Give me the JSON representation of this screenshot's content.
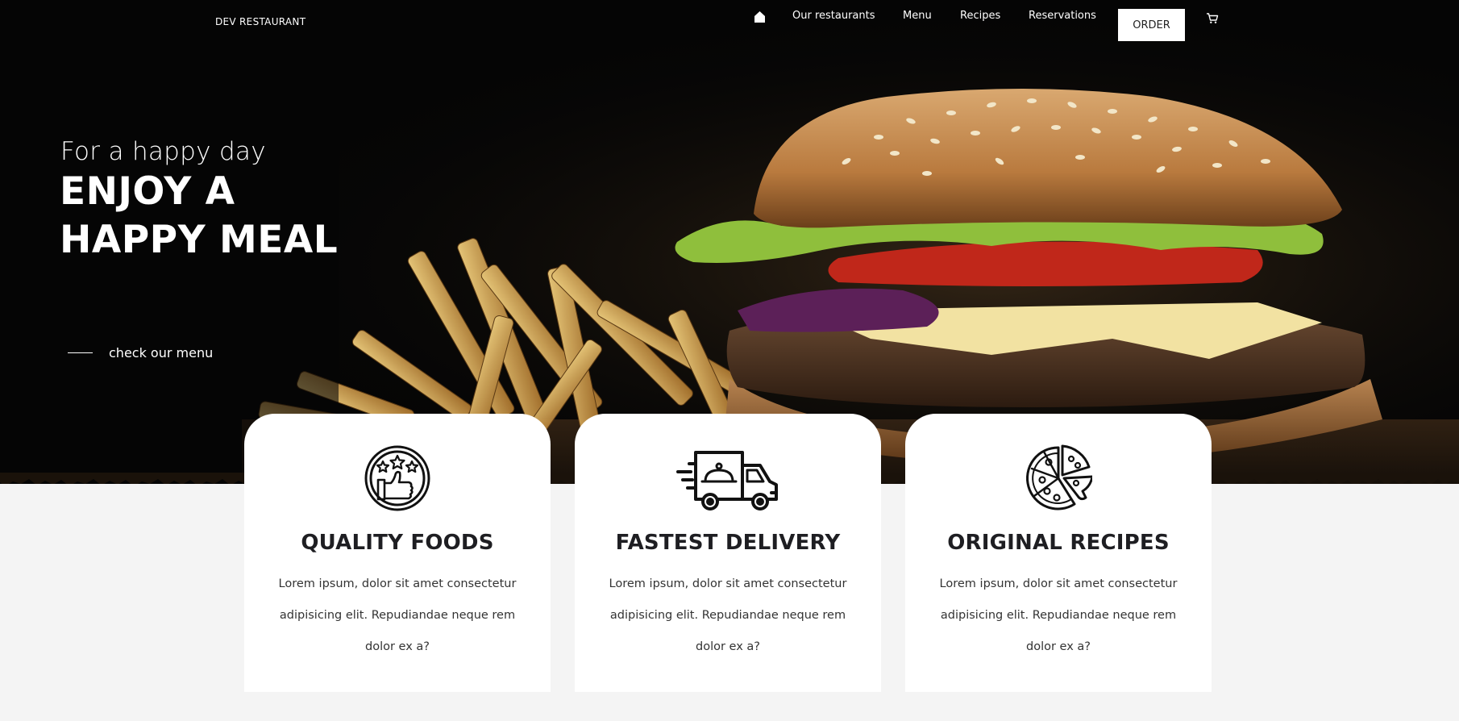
{
  "brand": "DEV RESTAURANT",
  "nav": {
    "items": [
      "Our restaurants",
      "Menu",
      "Recipes",
      "Reservations"
    ],
    "order_label": "ORDER"
  },
  "hero": {
    "tagline": "For a happy day",
    "headline_line1": "ENJOY A",
    "headline_line2": "HAPPY MEAL",
    "cta": "check our menu"
  },
  "features": [
    {
      "icon": "thumbs-up-stars-icon",
      "title": "QUALITY FOODS",
      "text": "Lorem ipsum, dolor sit amet consectetur adipisicing elit. Repudiandae neque rem dolor ex a?"
    },
    {
      "icon": "delivery-truck-icon",
      "title": "FASTEST DELIVERY",
      "text": "Lorem ipsum, dolor sit amet consectetur adipisicing elit. Repudiandae neque rem dolor ex a?"
    },
    {
      "icon": "pizza-icon",
      "title": "ORIGINAL RECIPES",
      "text": "Lorem ipsum, dolor sit amet consectetur adipisicing elit. Repudiandae neque rem dolor ex a?"
    }
  ],
  "colors": {
    "hero_bg": "#050505",
    "page_bg": "#f4f4f4",
    "card_bg": "#ffffff",
    "title": "#1e1e22"
  }
}
